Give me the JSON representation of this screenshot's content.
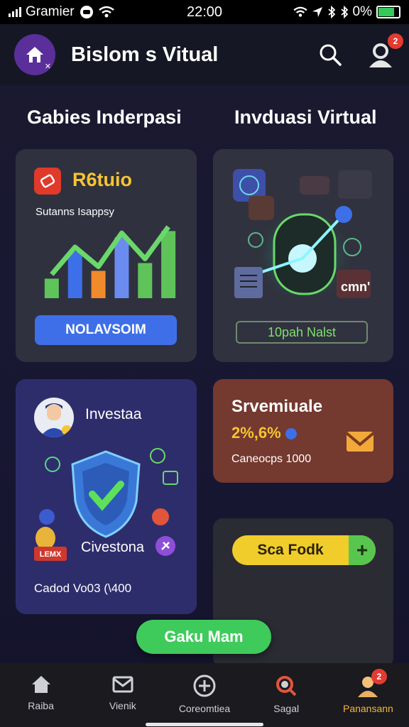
{
  "status_bar": {
    "carrier": "Gramier",
    "time": "22:00",
    "battery": "0%"
  },
  "app_bar": {
    "title": "Bislom s Vitual",
    "notification_count": "2"
  },
  "sections": {
    "left_title": "Gabies Inderpasi",
    "right_title": "Invduasi Virtual"
  },
  "card_studio": {
    "label": "R6tuio",
    "subtitle": "Sutanns Isappsy",
    "button": "NOLAVSOIM",
    "bar_values": [
      0.25,
      0.6,
      0.35,
      0.78,
      0.45,
      0.86
    ]
  },
  "card_virtual": {
    "chip_text": "cmn'",
    "button": "10pah Nalst"
  },
  "card_invest": {
    "title": "Investaa",
    "second_label": "Civestona",
    "coin_label": "LEMX",
    "footer": "Cadod Vo03 (\\400"
  },
  "card_summary": {
    "title": "Srvemiuale",
    "value": "2%,6%",
    "subtitle": "Caneocps 1000"
  },
  "card_action": {
    "button": "Sca Fodk",
    "plus": "+"
  },
  "floating_button": "Gaku Mam",
  "bottom_nav": [
    {
      "label": "Raiba",
      "icon": "home-icon"
    },
    {
      "label": "Vienik",
      "icon": "mail-icon"
    },
    {
      "label": "Coreomtiea",
      "icon": "plus-circle-icon"
    },
    {
      "label": "Sagal",
      "icon": "search-icon"
    },
    {
      "label": "Panansann",
      "icon": "profile-icon",
      "badge": "2"
    }
  ],
  "colors": {
    "accent_yellow": "#f6c531",
    "accent_green": "#3fcb5c",
    "accent_blue": "#3f6fe8",
    "badge_red": "#e23b32"
  }
}
